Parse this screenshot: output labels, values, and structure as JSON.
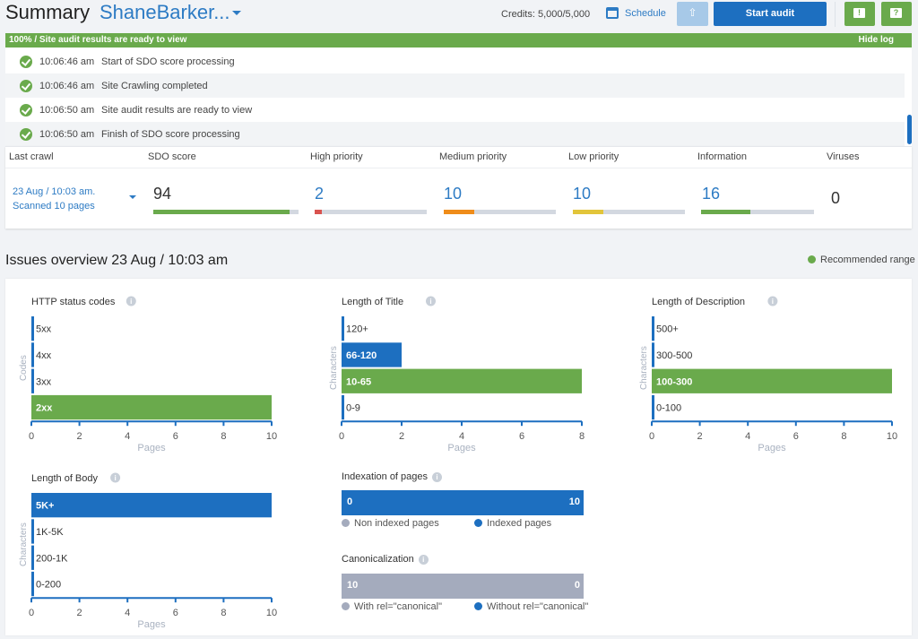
{
  "header": {
    "title": "Summary",
    "project": "ShaneBarker...",
    "credits": "Credits: 5,000/5,000",
    "schedule_label": "Schedule",
    "export_icon": "upload-icon",
    "start_audit_label": "Start audit",
    "feedback_icon": "!",
    "help_icon": "?"
  },
  "log": {
    "status": "100% / Site audit results are ready to view",
    "hide_label": "Hide log",
    "entries": [
      {
        "time": "10:06:46 am",
        "message": "Start of SDO score processing"
      },
      {
        "time": "10:06:46 am",
        "message": "Site Crawling completed"
      },
      {
        "time": "10:06:50 am",
        "message": "Site audit results are ready to view"
      },
      {
        "time": "10:06:50 am",
        "message": "Finish of SDO score processing"
      }
    ]
  },
  "stats": {
    "headers": [
      "Last crawl",
      "SDO score",
      "High priority",
      "Medium priority",
      "Low priority",
      "Information",
      "Viruses"
    ],
    "last_crawl_date": "23 Aug / 10:03 am.",
    "last_crawl_pages": "Scanned 10 pages",
    "sdo_score": "94",
    "high_priority": "2",
    "medium_priority": "10",
    "low_priority": "10",
    "information": "16",
    "viruses": "0",
    "bars": {
      "sdo": {
        "fraction": 0.94,
        "color": "#6aaa4c"
      },
      "high": {
        "fraction": 0.06,
        "color": "#d9534f"
      },
      "medium": {
        "fraction": 0.27,
        "color": "#ef8c1a"
      },
      "low": {
        "fraction": 0.27,
        "color": "#e2c53a"
      },
      "info": {
        "fraction": 0.44,
        "color": "#6aaa4c"
      }
    }
  },
  "issues": {
    "title": "Issues overview 23 Aug / 10:03 am",
    "recommended_label": "Recommended range",
    "colors": {
      "recommended": "#6aaa4c",
      "blue": "#1d6fc0",
      "grey": "#a4abbd"
    }
  },
  "chart_data": [
    {
      "type": "bar",
      "title": "HTTP status codes",
      "ylabel": "Codes",
      "xlabel": "Pages",
      "categories": [
        "5xx",
        "4xx",
        "3xx",
        "2xx"
      ],
      "values": [
        0,
        0,
        0,
        10
      ],
      "recommended": [
        false,
        false,
        false,
        true
      ],
      "xlim": [
        0,
        10
      ],
      "xticks": [
        "0",
        "2",
        "4",
        "6",
        "8",
        "10"
      ]
    },
    {
      "type": "bar",
      "title": "Length of Title",
      "ylabel": "Characters",
      "xlabel": "Pages",
      "categories": [
        "120+",
        "66-120",
        "10-65",
        "0-9"
      ],
      "values": [
        0,
        2,
        8,
        0
      ],
      "recommended": [
        false,
        false,
        true,
        false
      ],
      "xlim": [
        0,
        8
      ],
      "xticks": [
        "0",
        "2",
        "4",
        "6",
        "8"
      ]
    },
    {
      "type": "bar",
      "title": "Length of Description",
      "ylabel": "Characters",
      "xlabel": "Pages",
      "categories": [
        "500+",
        "300-500",
        "100-300",
        "0-100"
      ],
      "values": [
        0,
        0,
        10,
        0
      ],
      "recommended": [
        false,
        false,
        true,
        false
      ],
      "xlim": [
        0,
        10
      ],
      "xticks": [
        "0",
        "2",
        "4",
        "6",
        "8",
        "10"
      ]
    },
    {
      "type": "bar",
      "title": "Length of Body",
      "ylabel": "Characters",
      "xlabel": "Pages",
      "categories": [
        "5K+",
        "1K-5K",
        "200-1K",
        "0-200"
      ],
      "values": [
        10,
        0,
        0,
        0
      ],
      "recommended": [
        false,
        false,
        false,
        false
      ],
      "xlim": [
        0,
        10
      ],
      "xticks": [
        "0",
        "2",
        "4",
        "6",
        "8",
        "10"
      ]
    },
    {
      "type": "bar",
      "title": "Indexation of pages",
      "stacked": true,
      "series": [
        {
          "name": "Non indexed pages",
          "value": 0,
          "color": "#a4abbd"
        },
        {
          "name": "Indexed pages",
          "value": 10,
          "color": "#1d6fc0"
        }
      ]
    },
    {
      "type": "bar",
      "title": "Canonicalization",
      "stacked": true,
      "series": [
        {
          "name": "With rel=\"canonical\"",
          "value": 10,
          "color": "#a4abbd"
        },
        {
          "name": "Without rel=\"canonical\"",
          "value": 0,
          "color": "#1d6fc0"
        }
      ]
    }
  ]
}
